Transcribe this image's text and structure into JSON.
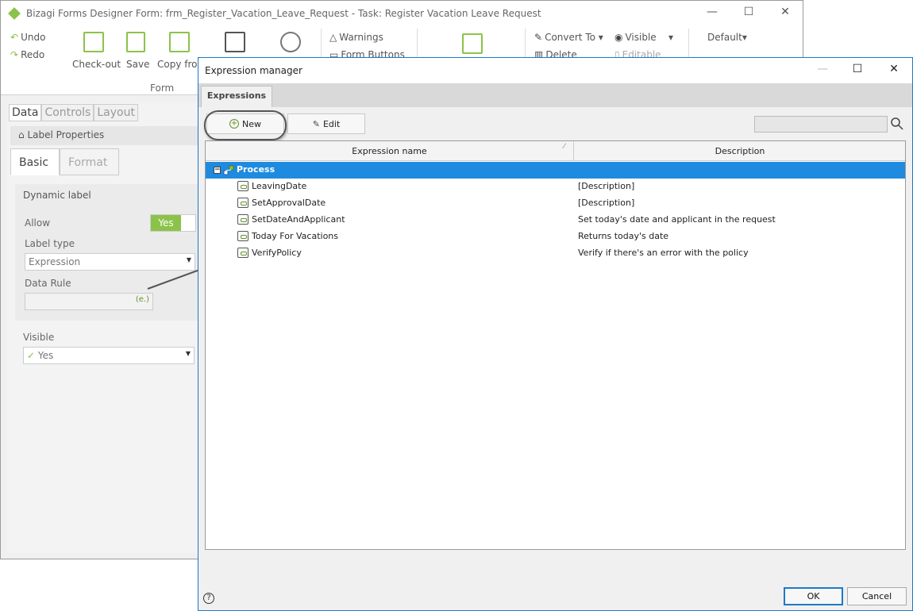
{
  "designer": {
    "title": "Bizagi Forms Designer   Form: frm_Register_Vacation_Leave_Request - Task:  Register Vacation Leave Request",
    "ribbon": {
      "undo": "Undo",
      "redo": "Redo",
      "checkout": "Check-out",
      "save": "Save",
      "copy_from": "Copy from",
      "warnings": "Warnings",
      "form_buttons": "Form Buttons",
      "convert_to": "Convert To",
      "delete": "Delete",
      "visible": "Visible",
      "editable": "Editable",
      "default": "Default",
      "form_group": "Form"
    },
    "panel": {
      "tabs": [
        "Data",
        "Controls",
        "Layout"
      ],
      "header": "Label Properties",
      "sub_tabs": [
        "Basic",
        "Format"
      ],
      "dynamic_label": "Dynamic label",
      "allow_label": "Allow",
      "allow_value": "Yes",
      "label_type_label": "Label type",
      "label_type_value": "Expression",
      "data_rule_label": "Data Rule",
      "data_rule_icon": "(e.)",
      "visible_label": "Visible",
      "visible_value": "Yes"
    }
  },
  "dialog": {
    "title": "Expression manager",
    "tab": "Expressions",
    "new_button": "New",
    "edit_button": "Edit",
    "columns": {
      "name": "Expression name",
      "description": "Description"
    },
    "root": "Process",
    "rows": [
      {
        "name": "LeavingDate",
        "description": "[Description]"
      },
      {
        "name": "SetApprovalDate",
        "description": "[Description]"
      },
      {
        "name": "SetDateAndApplicant",
        "description": "Set today's date and applicant in the request"
      },
      {
        "name": "Today For Vacations",
        "description": "Returns today's date"
      },
      {
        "name": "VerifyPolicy",
        "description": "Verify if there's an error with the policy"
      }
    ],
    "ok": "OK",
    "cancel": "Cancel"
  }
}
